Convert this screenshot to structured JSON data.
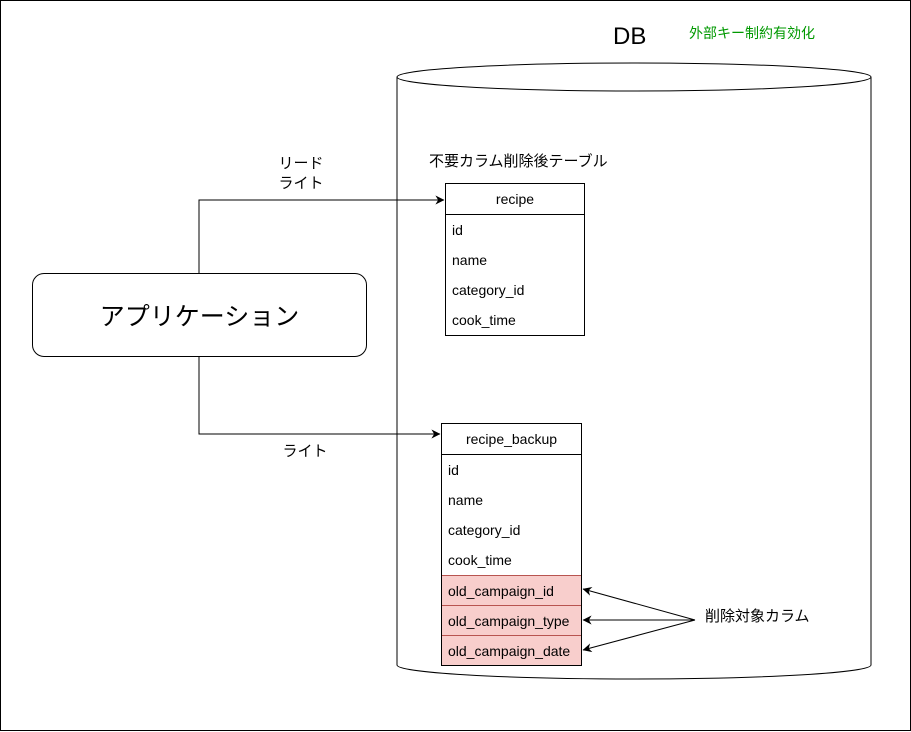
{
  "db": {
    "title": "DB",
    "fk_note": "外部キー制約有効化"
  },
  "application": {
    "label": "アプリケーション"
  },
  "edges": {
    "read_write_label": [
      "リード",
      "ライト"
    ],
    "write_label": "ライト"
  },
  "recipe_table": {
    "caption": "不要カラム削除後テーブル",
    "name": "recipe",
    "columns": [
      "id",
      "name",
      "category_id",
      "cook_time"
    ]
  },
  "backup_table": {
    "name": "recipe_backup",
    "columns": [
      "id",
      "name",
      "category_id",
      "cook_time"
    ],
    "deleted_columns": [
      "old_campaign_id",
      "old_campaign_type",
      "old_campaign_date"
    ]
  },
  "delete_note": "削除対象カラム",
  "colors": {
    "fk_note": "#009900",
    "deleted_fill": "#f8cecc",
    "deleted_stroke": "#b85450",
    "line": "#000000"
  }
}
